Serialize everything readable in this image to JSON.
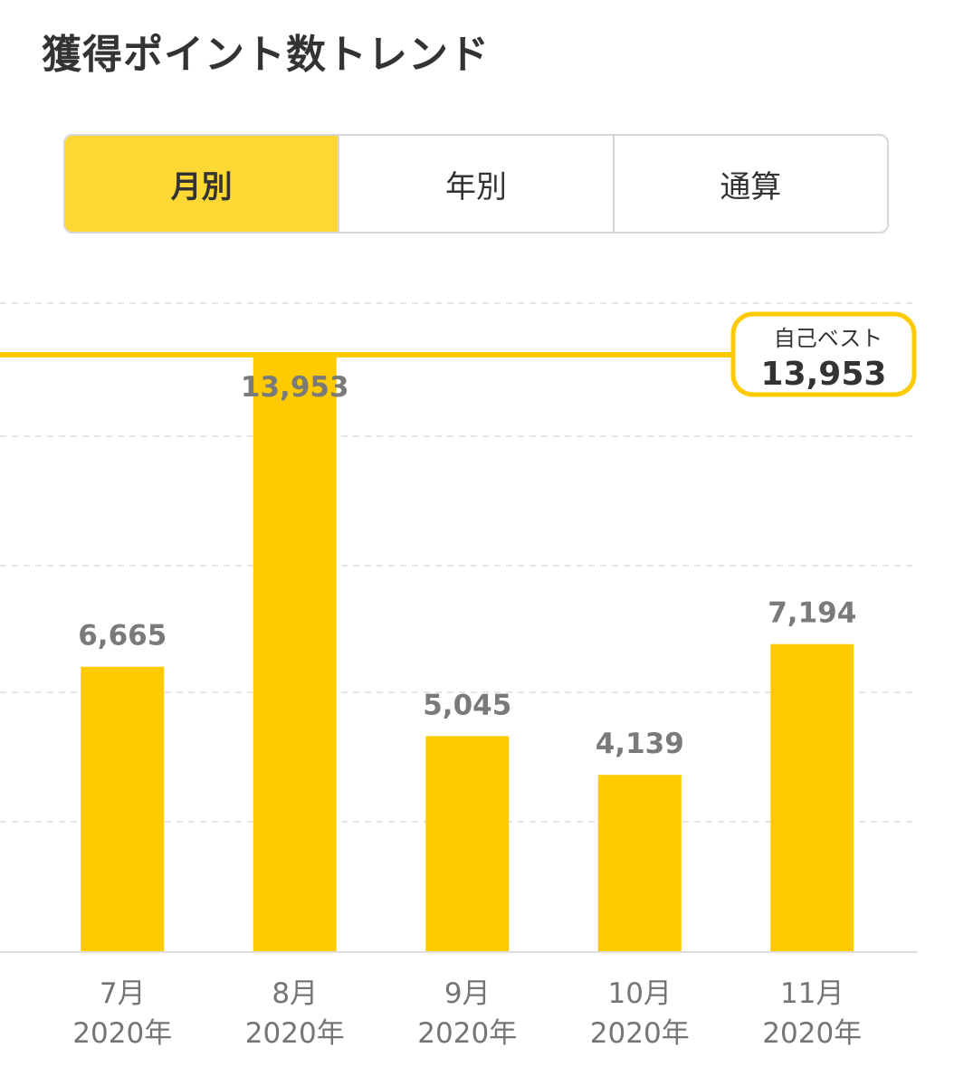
{
  "header": {
    "title": "獲得ポイント数トレンド"
  },
  "tabs": [
    {
      "label": "月別",
      "active": true
    },
    {
      "label": "年別",
      "active": false
    },
    {
      "label": "通算",
      "active": false
    }
  ],
  "colors": {
    "accent": "#FFCB00",
    "tab_active": "#FDD835",
    "value_label": "#7a7a7a",
    "axis_label": "#757575",
    "grid": "#e6e6e6"
  },
  "best": {
    "label": "自己ベスト",
    "value": "13,953",
    "amount": 13953
  },
  "chart_data": {
    "type": "bar",
    "categories": [
      {
        "month": "7月",
        "year": "2020年"
      },
      {
        "month": "8月",
        "year": "2020年"
      },
      {
        "month": "9月",
        "year": "2020年"
      },
      {
        "month": "10月",
        "year": "2020年"
      },
      {
        "month": "11月",
        "year": "2020年"
      }
    ],
    "values": [
      6665,
      13953,
      5045,
      4139,
      7194
    ],
    "value_labels": [
      "6,665",
      "13,953",
      "5,045",
      "4,139",
      "7,194"
    ],
    "title": "",
    "xlabel": "",
    "ylabel": "",
    "grid": true,
    "reference_line": {
      "label": "自己ベスト",
      "value": 13953
    }
  }
}
